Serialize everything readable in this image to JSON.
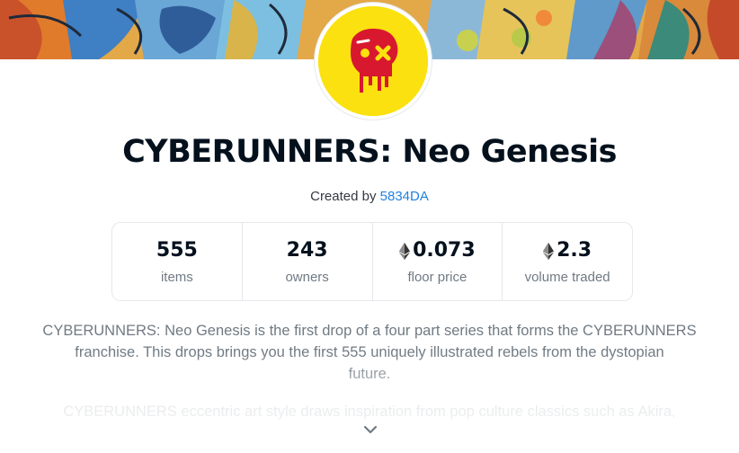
{
  "collection": {
    "title": "CYBERUNNERS: Neo Genesis",
    "created_by_prefix": "Created by",
    "creator": "5834DA"
  },
  "stats": [
    {
      "value": "555",
      "label": "items",
      "eth": false
    },
    {
      "value": "243",
      "label": "owners",
      "eth": false
    },
    {
      "value": "0.073",
      "label": "floor price",
      "eth": true
    },
    {
      "value": "2.3",
      "label": "volume traded",
      "eth": true
    }
  ],
  "description": {
    "lines": [
      "CYBERUNNERS: Neo Genesis is the first drop of a four part series that forms the CYBERUNNERS",
      "franchise. This drops brings you the first 555 uniquely illustrated rebels from the dystopian",
      "future."
    ],
    "second_paragraph": "CYBERUNNERS eccentric art style draws inspiration from pop culture classics such as Akira,"
  },
  "icons": {
    "currency": "ethereum-icon",
    "expand": "chevron-down-icon",
    "avatar": "dripping-skull-icon"
  },
  "colors": {
    "link": "#2081e2",
    "avatar_bg": "#fbe10f",
    "skull": "#d8182f"
  }
}
